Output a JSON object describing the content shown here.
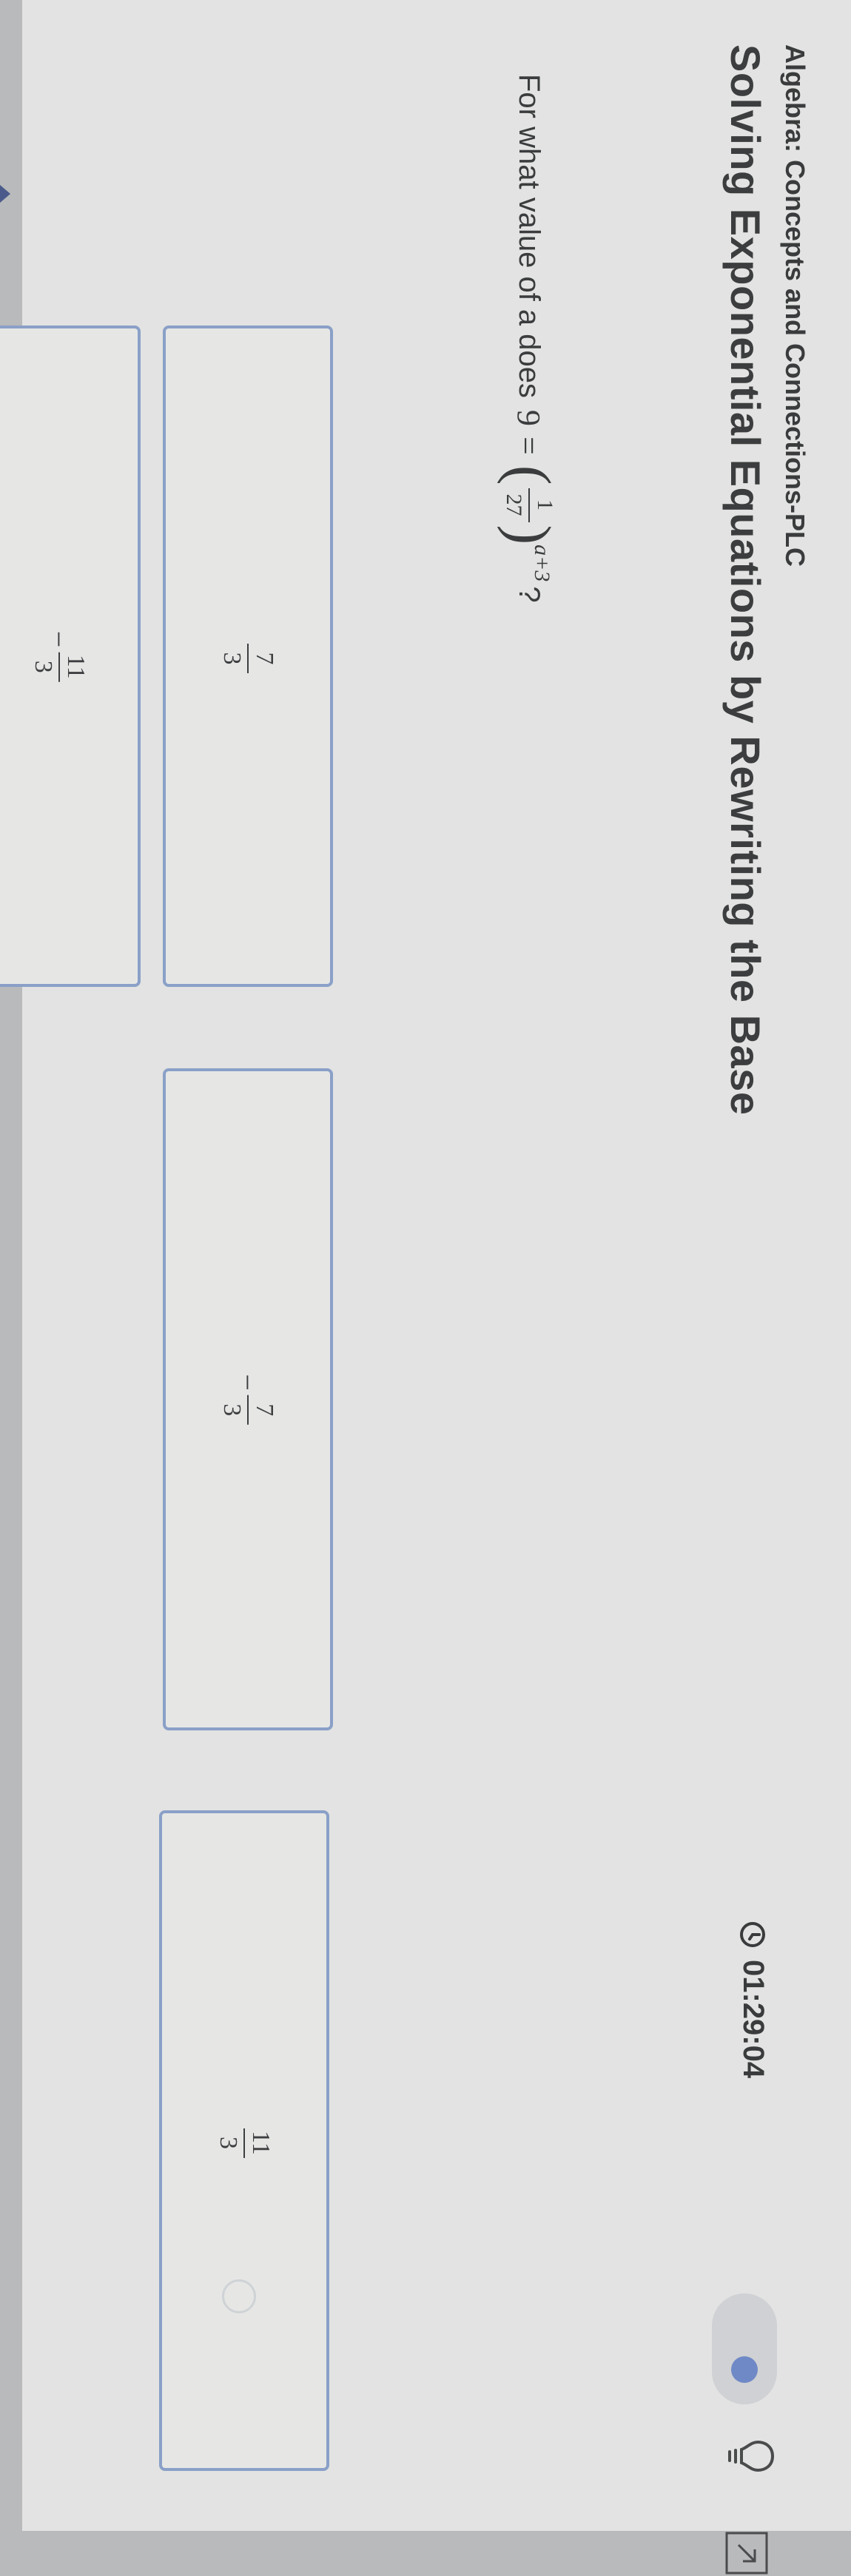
{
  "header": {
    "course": "Algebra: Concepts and Connections-PLC",
    "lesson_title": "Solving Exponential Equations by Rewriting the Base",
    "timer": "01:29:04"
  },
  "icons": {
    "timer": "clock-icon",
    "toggle": "toggle-switch",
    "hint": "lightbulb-icon",
    "expand": "expand-icon"
  },
  "question": {
    "prefix": "For what value of a does",
    "lhs": "9",
    "equals": "=",
    "base_numerator": "1",
    "base_denominator": "27",
    "exponent": "a+3",
    "suffix": "?"
  },
  "choices": [
    {
      "id": "a",
      "sign": "",
      "numerator": "7",
      "denominator": "3"
    },
    {
      "id": "b",
      "sign": "−",
      "numerator": "7",
      "denominator": "3"
    },
    {
      "id": "c",
      "sign": "",
      "numerator": "11",
      "denominator": "3"
    },
    {
      "id": "d",
      "sign": "−",
      "numerator": "11",
      "denominator": "3"
    }
  ],
  "colors": {
    "choice_border": "#8aa0c8",
    "toggle_knob": "#6f89c7",
    "text": "#3b3c3d"
  }
}
